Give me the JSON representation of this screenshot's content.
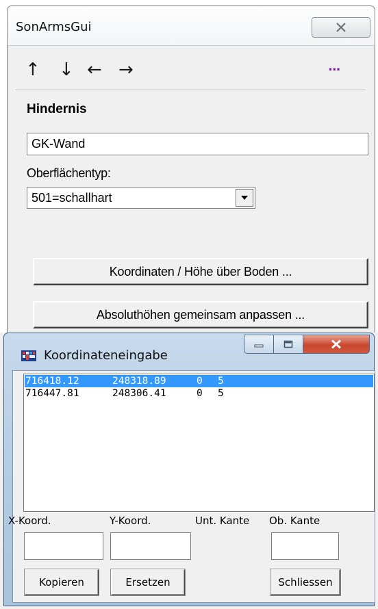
{
  "main_window": {
    "title": "SonArmsGui",
    "toolbar": {
      "up": "↑",
      "down": "↓",
      "left": "←",
      "right": "→",
      "more": "..."
    },
    "section_heading": "Hindernis",
    "name_value": "GK-Wand",
    "surface_label": "Oberflächentyp:",
    "surface_selected": "501=schallhart",
    "coordinates_button": "Koordinaten / Höhe über Boden ...",
    "absolute_heights_button": "Absoluthöhen gemeinsam anpassen ..."
  },
  "coord_dialog": {
    "title": "Koordinateneingabe",
    "rows": [
      {
        "x": "716418.12",
        "y": "248318.89",
        "lower": "0",
        "upper": "5"
      },
      {
        "x": "716447.81",
        "y": "248306.41",
        "lower": "0",
        "upper": "5"
      }
    ],
    "selected_row": 0,
    "labels": {
      "x": "X-Koord.",
      "y": "Y-Koord.",
      "lower": "Unt. Kante",
      "upper": "Ob. Kante"
    },
    "inputs": {
      "x": "",
      "y": "",
      "upper": ""
    },
    "buttons": {
      "copy": "Kopieren",
      "replace": "Ersetzen",
      "close": "Schliessen"
    }
  },
  "colors": {
    "selection": "#3399ff",
    "close_red": "#c9462d",
    "more_purple": "#7a1fa0"
  }
}
